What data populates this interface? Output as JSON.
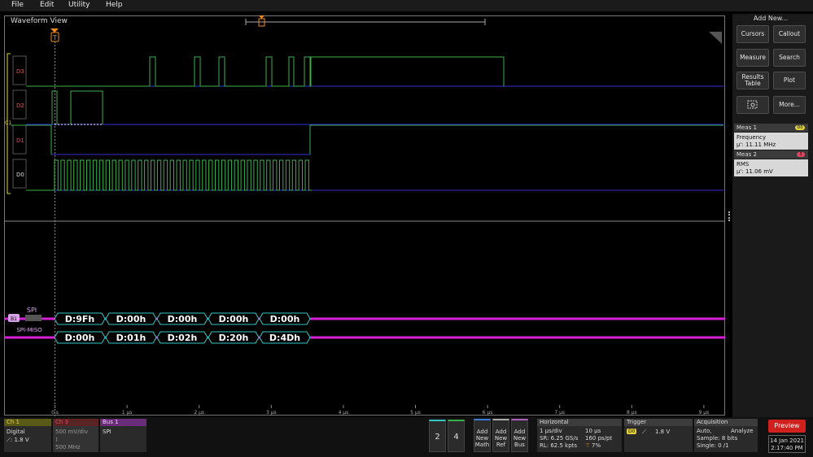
{
  "menu": {
    "items": [
      "File",
      "Edit",
      "Utility",
      "Help"
    ]
  },
  "waveform_view": {
    "title": "Waveform View",
    "trigger_marker": "T",
    "channels": [
      "D3",
      "D2",
      "C1",
      "D1",
      "D0"
    ],
    "bus": {
      "badge": "B1",
      "label": "SPI",
      "miso_label": "SPI-MISO",
      "mosi_packets": [
        "D:9Fh",
        "D:00h",
        "D:00h",
        "D:00h",
        "D:00h"
      ],
      "miso_packets": [
        "D:00h",
        "D:01h",
        "D:02h",
        "D:20h",
        "D:4Dh"
      ]
    },
    "time_ticks": [
      "0 s",
      "1 µs",
      "2 µs",
      "3 µs",
      "4 µs",
      "5 µs",
      "6 µs",
      "7 µs",
      "8 µs",
      "9 µs"
    ],
    "colors": {
      "green": "#3ab14a",
      "blue": "#2f2fd8",
      "magenta": "#d81fd8",
      "cyan": "#36c6c6",
      "orange": "#f28a1c"
    }
  },
  "right_panel": {
    "title": "Add New...",
    "buttons": [
      "Cursors",
      "Callout",
      "Measure",
      "Search",
      "Results Table",
      "Plot",
      "More..."
    ],
    "meas1": {
      "title": "Meas 1",
      "badge": "D0",
      "name": "Frequency",
      "value": "µ': 11.11 MHz"
    },
    "meas2": {
      "title": "Meas 2",
      "badge": "3",
      "name": "RMS",
      "value": "µ': 11.06 mV"
    }
  },
  "bottom": {
    "ch1": {
      "title": "Ch 1",
      "line1": "Digital",
      "line2": "⟋: 1.8 V"
    },
    "ch3": {
      "title": "Ch 3",
      "line1": "500 mV/div",
      "line2": "500 MHz"
    },
    "bus1": {
      "title": "Bus 1",
      "line1": "SPI"
    },
    "num_buttons": [
      "2",
      "4"
    ],
    "add_buttons": [
      "Add New Math",
      "Add New Ref",
      "Add New Bus"
    ],
    "horizontal": {
      "title": "Horizontal",
      "l1a": "1 µs/div",
      "l1b": "10 µs",
      "l2a": "SR: 6.25 GS/s",
      "l2b": "160 ps/pt",
      "l3a": "RL: 62.5 kpts",
      "l3b": "7%"
    },
    "trigger": {
      "title": "Trigger",
      "source": "D0",
      "level": "1.8 V"
    },
    "acquisition": {
      "title": "Acquisition",
      "l1a": "Auto,",
      "l1b": "Analyze",
      "l2": "Sample: 8 bits",
      "l3": "Single: 0 /1"
    },
    "preview": "Preview",
    "date": "14 Jan 2021",
    "time": "2:17:40 PM"
  }
}
